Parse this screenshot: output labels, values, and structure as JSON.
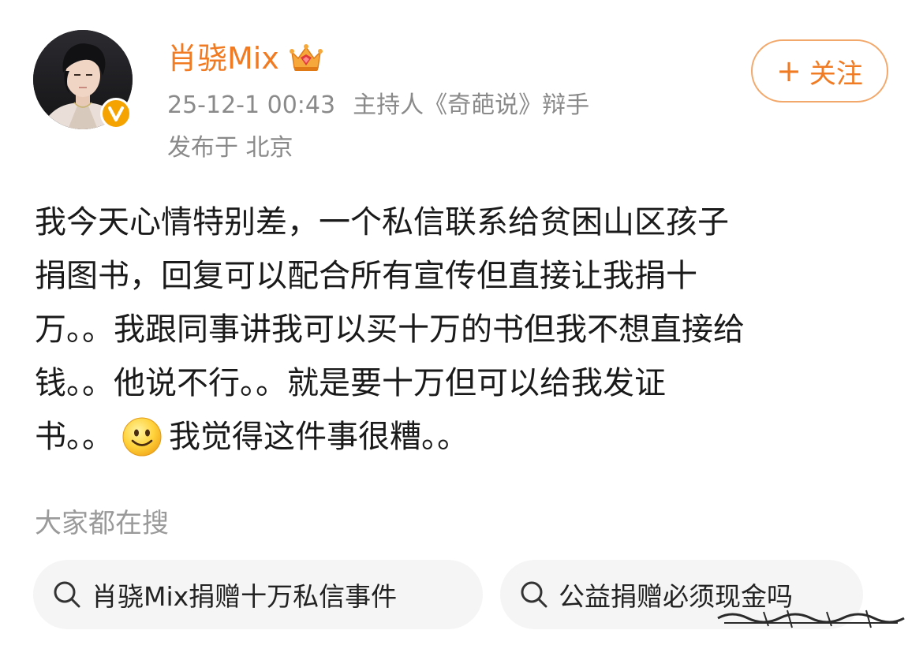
{
  "author": {
    "name": "肖骁Mix",
    "crown_icon": "crown-icon",
    "verified_icon": "verified-v-icon",
    "avatar": "avatar-photo"
  },
  "meta": {
    "timestamp": "25-12-1 00:43",
    "title": "主持人《奇葩说》辩手",
    "location": "发布于 北京"
  },
  "follow_button": {
    "plus_icon": "+",
    "label": "关注"
  },
  "post": {
    "lines": [
      "我今天心情特别差，一个私信联系给贫困山区孩子",
      "捐图书，回复可以配合所有宣传但直接让我捐十",
      "万。。我跟同事讲我可以买十万的书但我不想直接给",
      "钱。。他说不行。。就是要十万但可以给我发证"
    ],
    "last_line_before_emoji": "书。。",
    "emoji": "smile-icon",
    "last_line_after_emoji": "我觉得这件事很糟。。"
  },
  "trending": {
    "heading": "大家都在搜",
    "items": [
      {
        "label": "肖骁Mix捐赠十万私信事件",
        "icon": "search-icon"
      },
      {
        "label": "公益捐赠必须现金吗",
        "icon": "search-icon"
      }
    ]
  },
  "colors": {
    "accent": "#f07b22",
    "verified": "#f5a300",
    "text": "#1a1a1a",
    "muted": "#8a8a8a",
    "chip_bg": "#f5f5f5"
  }
}
